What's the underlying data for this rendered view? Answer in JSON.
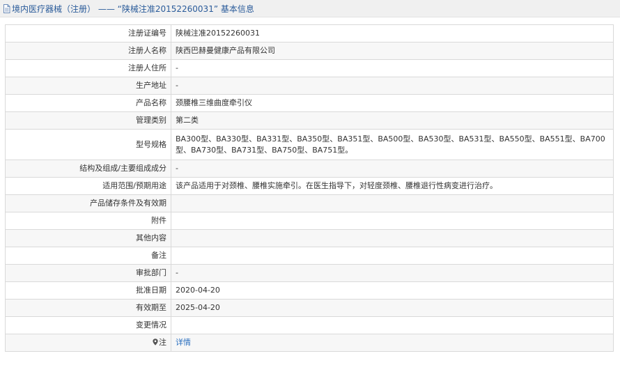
{
  "header": {
    "title": "境内医疗器械（注册） —— “陕械注准20152260031” 基本信息",
    "icon": "document-icon"
  },
  "rows": [
    {
      "label": "注册证编号",
      "value": "陕械注准20152260031"
    },
    {
      "label": "注册人名称",
      "value": "陕西巴赫曼健康产品有限公司"
    },
    {
      "label": "注册人住所",
      "value": "-"
    },
    {
      "label": "生产地址",
      "value": "-"
    },
    {
      "label": "产品名称",
      "value": "颈腰椎三维曲度牵引仪"
    },
    {
      "label": "管理类别",
      "value": "第二类"
    },
    {
      "label": "型号规格",
      "value": "BA300型、BA330型、BA331型、BA350型、BA351型、BA500型、BA530型、BA531型、BA550型、BA551型、BA700型、BA730型、BA731型、BA750型、BA751型。"
    },
    {
      "label": "结构及组成/主要组成成分",
      "value": "-"
    },
    {
      "label": "适用范围/预期用途",
      "value": "该产品适用于对颈椎、腰椎实施牵引。在医生指导下，对轻度颈椎、腰椎退行性病变进行治疗。"
    },
    {
      "label": "产品储存条件及有效期",
      "value": ""
    },
    {
      "label": "附件",
      "value": ""
    },
    {
      "label": "其他内容",
      "value": ""
    },
    {
      "label": "备注",
      "value": ""
    },
    {
      "label": "审批部门",
      "value": "-"
    },
    {
      "label": "批准日期",
      "value": "2020-04-20"
    },
    {
      "label": "有效期至",
      "value": "2025-04-20"
    },
    {
      "label": "变更情况",
      "value": ""
    }
  ],
  "note_row": {
    "label": "注",
    "link_text": "详情",
    "icon": "location-pin-icon"
  },
  "colors": {
    "header_bg": "#f0f0f0",
    "title_text": "#2a5b9a",
    "link": "#2a6fbf",
    "border": "#d9d9d9",
    "alt_row_bg": "#f7f7f7"
  }
}
